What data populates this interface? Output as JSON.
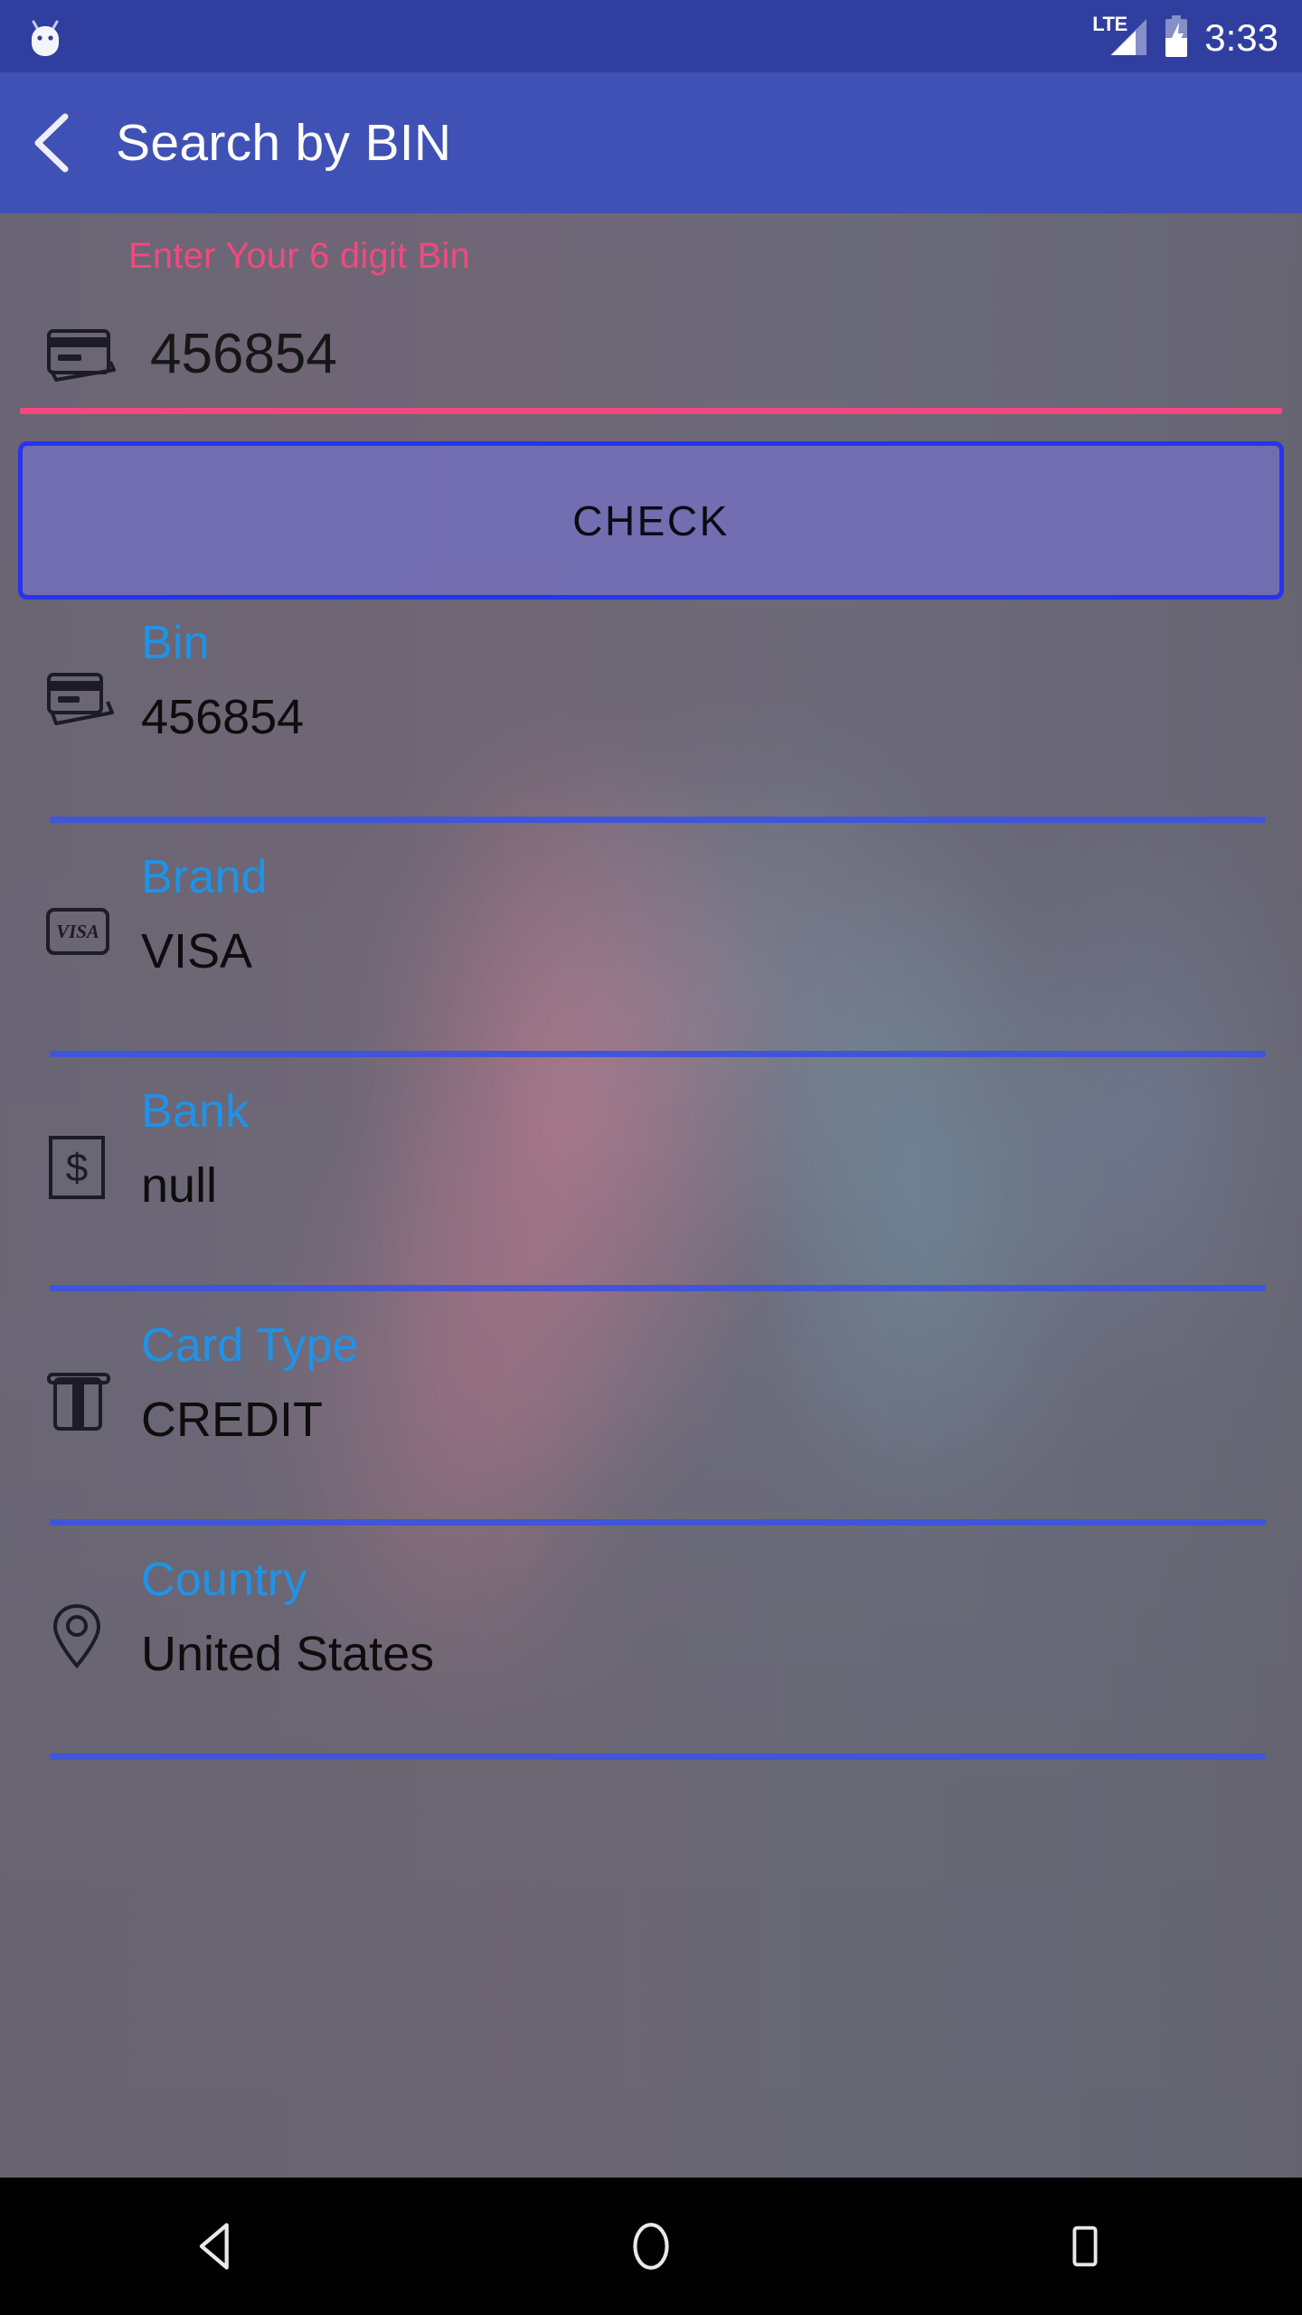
{
  "status_bar": {
    "time": "3:33",
    "network_label": "LTE",
    "icons": [
      "android-head-icon",
      "lte-signal-icon",
      "battery-charging-icon"
    ],
    "background_color": "#303f9f"
  },
  "app_bar": {
    "title": "Search by BIN",
    "back_icon": "back-chevron-icon",
    "background_color": "#3f51b5",
    "title_color": "#ffffff"
  },
  "bin_input": {
    "hint": "Enter Your 6 digit Bin",
    "hint_color": "#f2497e",
    "value": "456854",
    "placeholder": "Enter Your 6 digit Bin",
    "icon": "credit-card-icon",
    "underline_color": "#f2497e"
  },
  "check_button": {
    "label": "CHECK",
    "border_color": "#2733ee",
    "fill_color": "#7470c8",
    "text_color": "#0a0a12"
  },
  "results": {
    "label_color": "#1e93e8",
    "value_color": "#0d0d0d",
    "divider_color": "#4055d8",
    "rows": [
      {
        "label": "Bin",
        "value": "456854",
        "icon": "credit-cards-icon"
      },
      {
        "label": "Brand",
        "value": "VISA",
        "icon": "visa-card-icon"
      },
      {
        "label": "Bank",
        "value": "null",
        "icon": "dollar-bank-icon"
      },
      {
        "label": "Card Type",
        "value": "CREDIT",
        "icon": "atm-card-slot-icon"
      },
      {
        "label": "Country",
        "value": "United States",
        "icon": "location-pin-icon"
      }
    ]
  },
  "nav_bar": {
    "background_color": "#000000",
    "buttons": [
      {
        "name": "back",
        "icon": "triangle-back-icon"
      },
      {
        "name": "home",
        "icon": "circle-home-icon"
      },
      {
        "name": "recents",
        "icon": "square-recents-icon"
      }
    ]
  }
}
